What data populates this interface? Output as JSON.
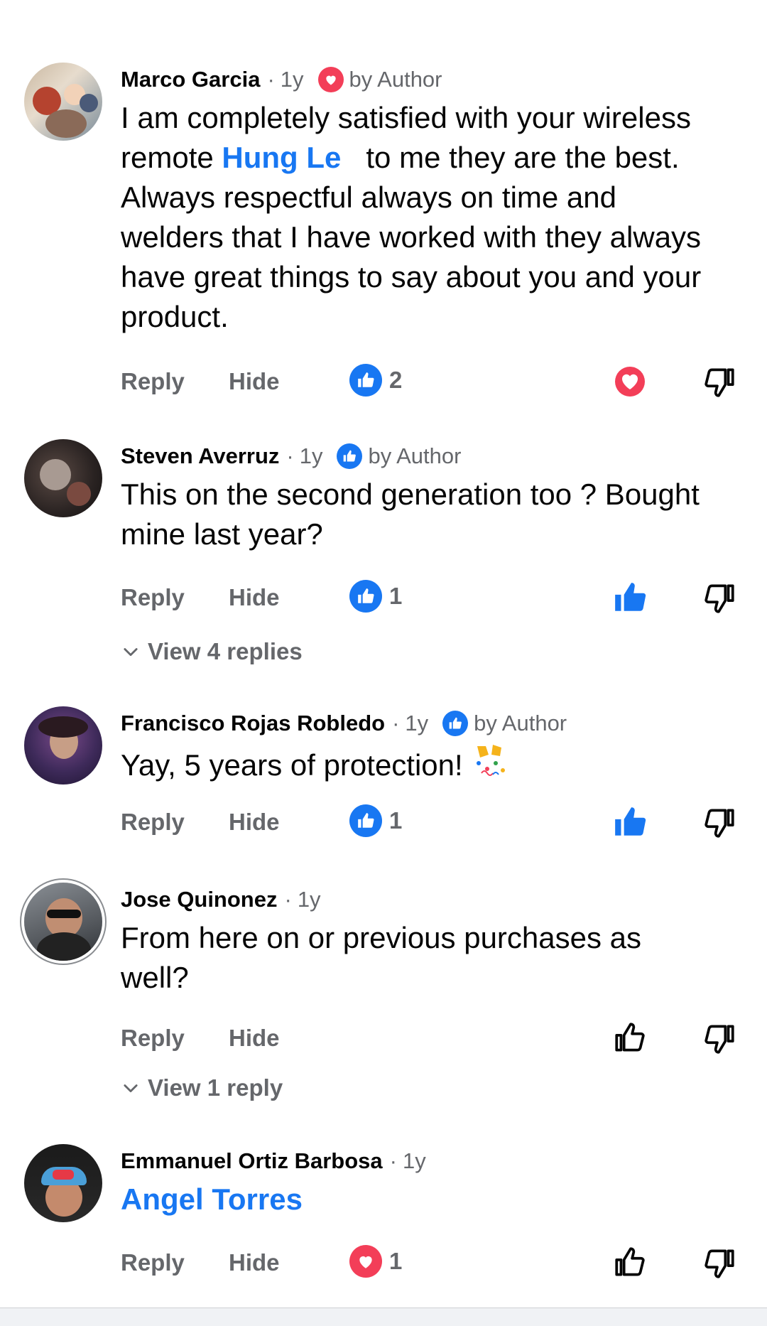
{
  "colors": {
    "accent": "#1877f2",
    "heart": "#f33e58",
    "secondary_text": "#65676b"
  },
  "labels": {
    "reply": "Reply",
    "hide": "Hide",
    "separator": "·"
  },
  "comments": [
    {
      "author": "Marco Garcia",
      "time": "1y",
      "author_reaction": "heart",
      "badge_text": "by Author",
      "text_lines": [
        {
          "before": "I am completely satisfied with your wireless"
        },
        {
          "before": "remote ",
          "mention": "Hung Le",
          "after": "   to me they are the best."
        },
        {
          "before": "Always respectful always on time and"
        },
        {
          "before": "welders that I have worked with they always"
        },
        {
          "before": "have great things to say about you and your"
        },
        {
          "before": "product."
        }
      ],
      "reaction_type": "like",
      "reaction_count": "2",
      "user_vote": "heart"
    },
    {
      "author": "Steven Averruz",
      "time": "1y",
      "author_reaction": "like",
      "badge_text": "by Author",
      "text_lines": [
        {
          "before": "This on the second generation too ? Bought"
        },
        {
          "before": "mine last year?"
        }
      ],
      "reaction_type": "like",
      "reaction_count": "1",
      "user_vote": "like-filled",
      "view_replies": "View 4 replies"
    },
    {
      "author": "Francisco Rojas Robledo",
      "time": "1y",
      "author_reaction": "like",
      "badge_text": "by Author",
      "text_lines": [
        {
          "before": "Yay, 5 years of protection!",
          "emoji": "confetti-icon"
        }
      ],
      "reaction_type": "like",
      "reaction_count": "1",
      "user_vote": "like-filled"
    },
    {
      "author": "Jose Quinonez",
      "time": "1y",
      "text_lines": [
        {
          "before": "From here on or previous purchases as"
        },
        {
          "before": "well?"
        }
      ],
      "user_vote": "none",
      "view_replies": "View 1 reply"
    },
    {
      "author": "Emmanuel Ortiz Barbosa",
      "time": "1y",
      "text_lines": [
        {
          "mention": "Angel Torres"
        }
      ],
      "reaction_type": "heart",
      "reaction_count": "1",
      "user_vote": "none"
    }
  ]
}
